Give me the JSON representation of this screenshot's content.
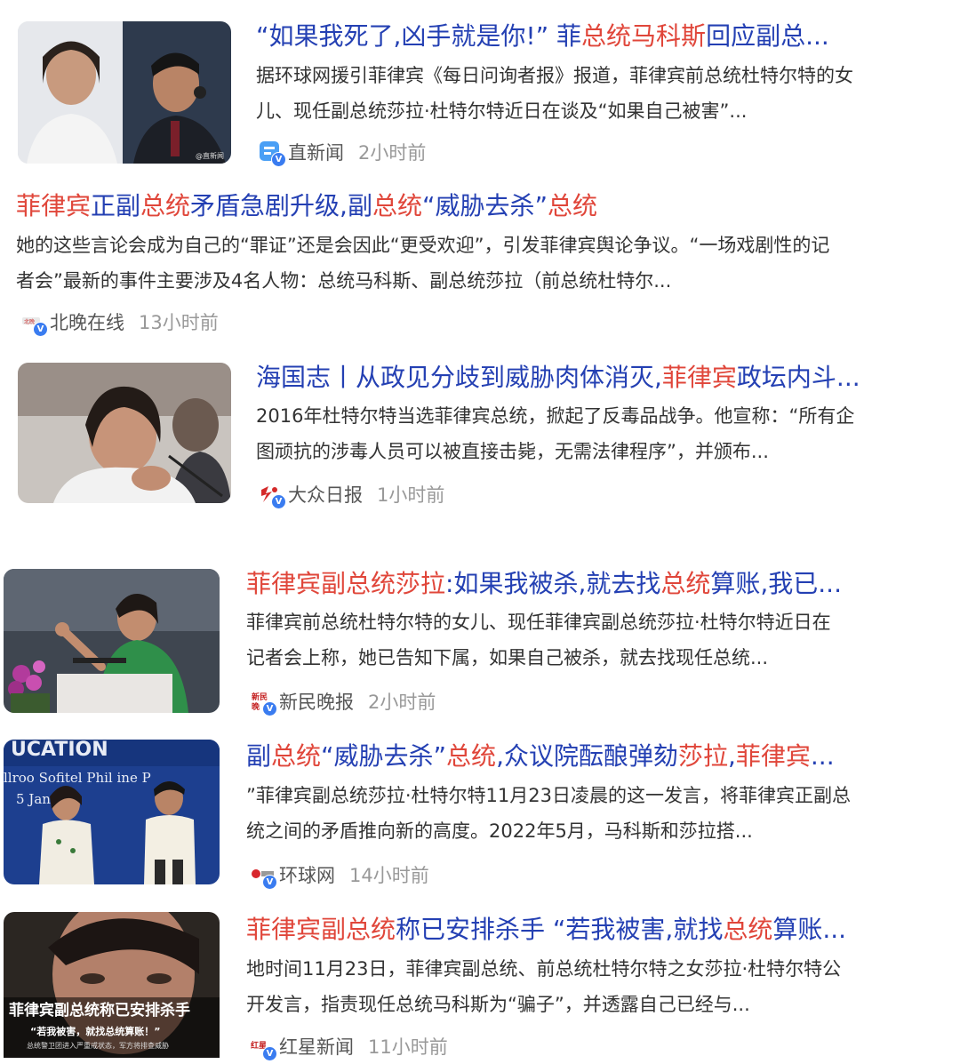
{
  "results": [
    {
      "title_parts": [
        {
          "t": "“如果我死了,凶手就是你!” 菲",
          "hl": false
        },
        {
          "t": "总统马科斯",
          "hl": true
        },
        {
          "t": "回应副总...",
          "hl": false
        }
      ],
      "snippet": [
        "据环球网援引菲律宾《每日问询者报》报道，菲律宾前总统杜特尔特的女",
        "儿、现任副总统莎拉·杜特尔特近日在谈及“如果自己被害”..."
      ],
      "source": "直新闻",
      "time": "2小时前",
      "thumb_watermark": "@直新闻"
    },
    {
      "title_parts": [
        {
          "t": "菲律宾",
          "hl": true
        },
        {
          "t": "正副",
          "hl": false
        },
        {
          "t": "总统",
          "hl": true
        },
        {
          "t": "矛盾急剧升级,副",
          "hl": false
        },
        {
          "t": "总统",
          "hl": true
        },
        {
          "t": "“威胁去杀”",
          "hl": false
        },
        {
          "t": "总统",
          "hl": true
        }
      ],
      "snippet": [
        "她的这些言论会成为自己的“罪证”还是会因此“更受欢迎”，引发菲律宾舆论争议。“一场戏剧性的记",
        "者会”最新的事件主要涉及4名人物：总统马科斯、副总统莎拉（前总统杜特尔..."
      ],
      "source": "北晚在线",
      "time": "13小时前"
    },
    {
      "title_parts": [
        {
          "t": "海国志丨从政见分歧到威胁肉体消灭,",
          "hl": false
        },
        {
          "t": "菲律宾",
          "hl": true
        },
        {
          "t": "政坛内斗...",
          "hl": false
        }
      ],
      "snippet": [
        "2016年杜特尔特当选菲律宾总统，掀起了反毒品战争。他宣称：“所有企",
        "图顽抗的涉毒人员可以被直接击毙，无需法律程序”，并颁布..."
      ],
      "source": "大众日报",
      "time": "1小时前"
    },
    {
      "title_parts": [
        {
          "t": "菲律宾副总统莎拉",
          "hl": true
        },
        {
          "t": ":如果我被杀,就去找",
          "hl": false
        },
        {
          "t": "总统",
          "hl": true
        },
        {
          "t": "算账,我已...",
          "hl": false
        }
      ],
      "snippet": [
        "菲律宾前总统杜特尔特的女儿、现任菲律宾副总统莎拉·杜特尔特近日在",
        "记者会上称，她已告知下属，如果自己被杀，就去找现任总统..."
      ],
      "source": "新民晚报",
      "time": "2小时前"
    },
    {
      "title_parts": [
        {
          "t": "副",
          "hl": false
        },
        {
          "t": "总统",
          "hl": true
        },
        {
          "t": "“威胁去杀”",
          "hl": false
        },
        {
          "t": "总统",
          "hl": true
        },
        {
          "t": ",众议院酝酿弹劾",
          "hl": false
        },
        {
          "t": "莎拉",
          "hl": true
        },
        {
          "t": ",",
          "hl": false
        },
        {
          "t": "菲律宾",
          "hl": true
        },
        {
          "t": "...",
          "hl": false
        }
      ],
      "snippet": [
        "”菲律宾副总统莎拉·杜特尔特11月23日凌晨的这一发言，将菲律宾正副总",
        "统之间的矛盾推向新的高度。2022年5月，马科斯和莎拉搭..."
      ],
      "source": "环球网",
      "time": "14小时前",
      "thumb_text": [
        "UCATION",
        "llroo  Sofitel Phil   ine P",
        "5 Janu          4"
      ]
    },
    {
      "title_parts": [
        {
          "t": "菲律宾副总统",
          "hl": true
        },
        {
          "t": "称已安排杀手 “若我被害,就找",
          "hl": false
        },
        {
          "t": "总统",
          "hl": true
        },
        {
          "t": "算账...",
          "hl": false
        }
      ],
      "snippet": [
        "地时间11月23日，菲律宾副总统、前总统杜特尔特之女莎拉·杜特尔特公",
        "开发言，指责现任总统马科斯为“骗子”，并透露自己已经与..."
      ],
      "source": "红星新闻",
      "time": "11小时前",
      "thumb_text": [
        "菲律宾副总统称已安排杀手",
        "“若我被害，就找总统算账！”",
        "总统警卫团进入严重戒状态，军方将排查威胁"
      ]
    }
  ]
}
